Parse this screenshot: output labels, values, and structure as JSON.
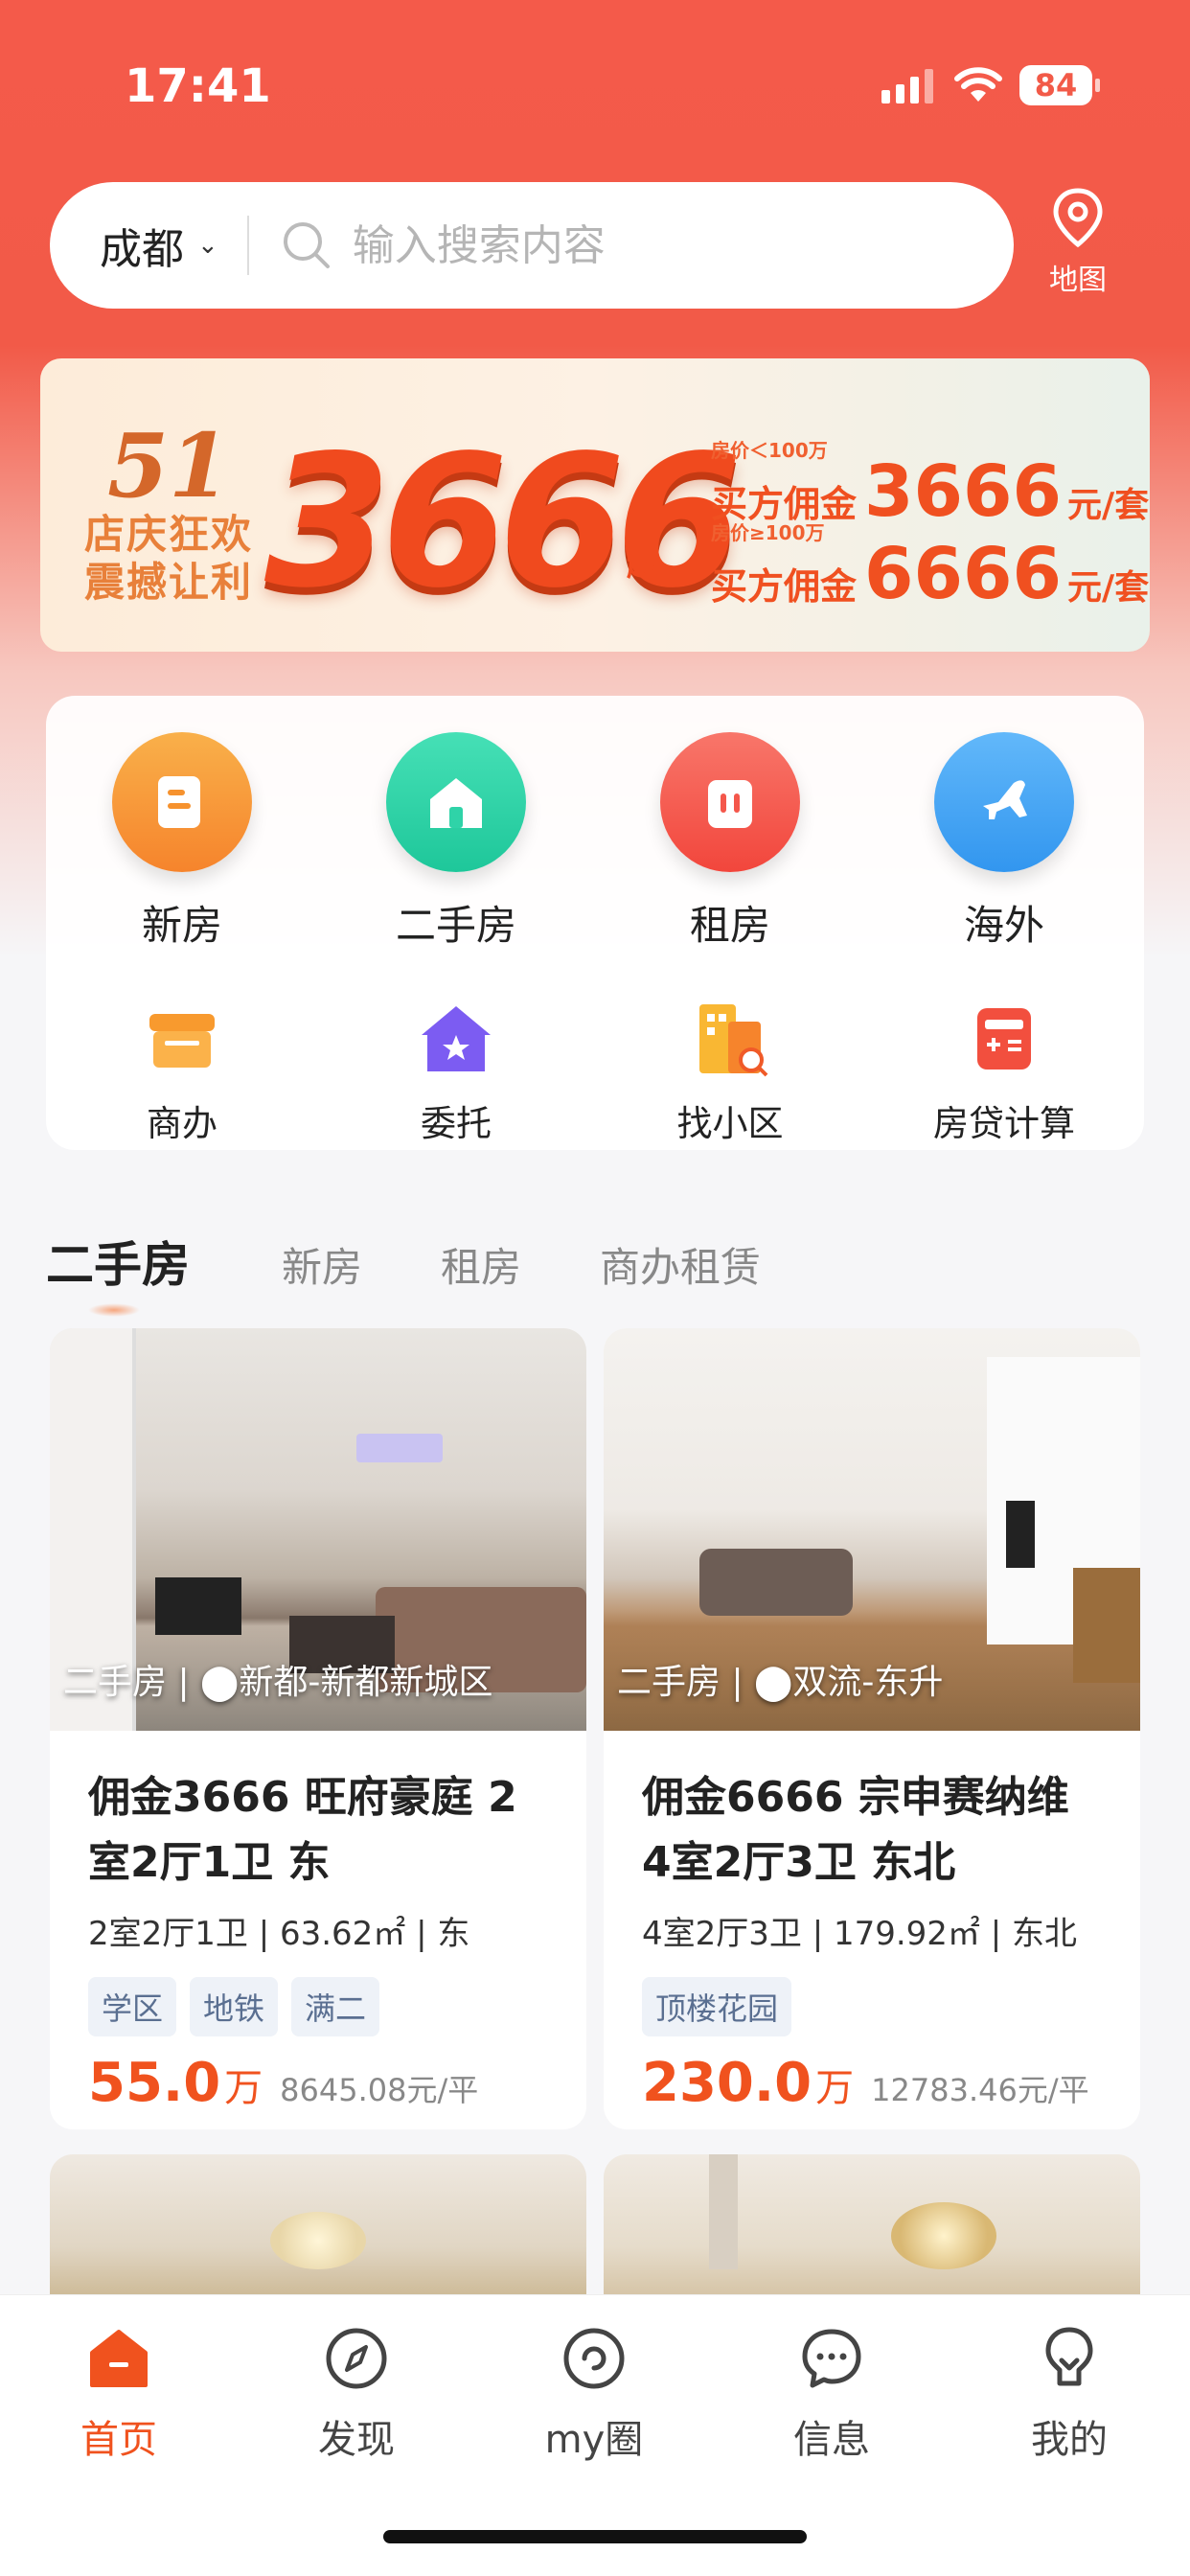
{
  "status": {
    "time": "17:41",
    "battery": "84"
  },
  "search": {
    "city": "成都",
    "placeholder": "输入搜索内容",
    "map_label": "地图"
  },
  "banner": {
    "brand_number": "51",
    "tag_line1": "店庆狂欢",
    "tag_line2": "震撼让利",
    "big_price": "3666",
    "qi": "起",
    "offer1": {
      "note": "房价＜100万",
      "label": "买方佣金",
      "amount": "3666",
      "unit": "元/套"
    },
    "offer2": {
      "note": "房价≥100万",
      "label": "买方佣金",
      "amount": "6666",
      "unit": "元/套"
    }
  },
  "services": {
    "main": [
      {
        "label": "新房",
        "icon": "document-icon",
        "color": "#f79a3c"
      },
      {
        "label": "二手房",
        "icon": "house-icon",
        "color": "#2fd3a8"
      },
      {
        "label": "租房",
        "icon": "suitcase-icon",
        "color": "#f4574b"
      },
      {
        "label": "海外",
        "icon": "airplane-icon",
        "color": "#47a8f5"
      }
    ],
    "secondary": [
      {
        "label": "商办",
        "icon": "shop-icon"
      },
      {
        "label": "委托",
        "icon": "home-star-icon"
      },
      {
        "label": "找小区",
        "icon": "building-search-icon"
      },
      {
        "label": "房贷计算",
        "icon": "calculator-icon"
      }
    ]
  },
  "tabs": [
    "二手房",
    "新房",
    "租房",
    "商办租赁"
  ],
  "listings": [
    {
      "caption_type": "二手房",
      "caption_location": "新都-新都新城区",
      "title": "佣金3666 旺府豪庭 2室2厅1卫 东",
      "meta": "2室2厅1卫 | 63.62㎡ | 东",
      "tags": [
        "学区",
        "地铁",
        "满二"
      ],
      "price": "55.0",
      "price_unit": "万",
      "unit_price": "8645.08元/平"
    },
    {
      "caption_type": "二手房",
      "caption_location": "双流-东升",
      "title": "佣金6666 宗申赛纳维 4室2厅3卫 东北",
      "meta": "4室2厅3卫 | 179.92㎡ | 东北",
      "tags": [
        "顶楼花园"
      ],
      "price": "230.0",
      "price_unit": "万",
      "unit_price": "12783.46元/平"
    }
  ],
  "bottom_nav": [
    {
      "label": "首页",
      "icon": "home-icon",
      "active": true
    },
    {
      "label": "发现",
      "icon": "compass-icon",
      "active": false
    },
    {
      "label": "my圈",
      "icon": "circle-icon",
      "active": false
    },
    {
      "label": "信息",
      "icon": "message-icon",
      "active": false
    },
    {
      "label": "我的",
      "icon": "profile-icon",
      "active": false
    }
  ],
  "colors": {
    "accent": "#f0521e",
    "header": "#f45a4a"
  }
}
